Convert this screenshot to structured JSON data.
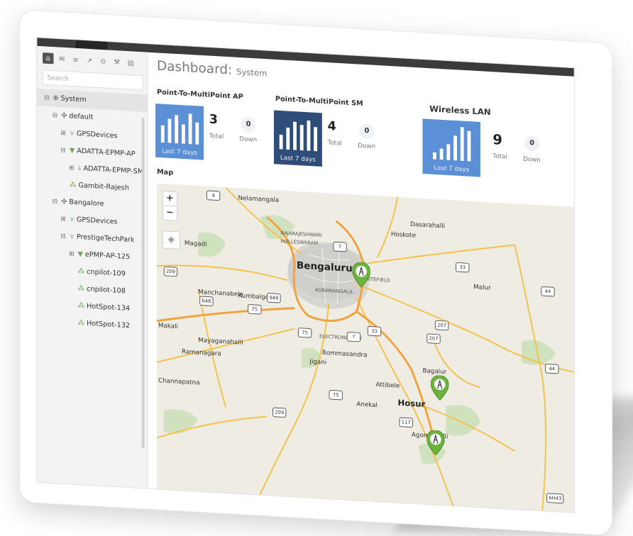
{
  "app": {
    "title": "Dashboard:",
    "subtitle": "System"
  },
  "sidebar": {
    "icons": [
      "home-icon",
      "megaphone-icon",
      "list-icon",
      "chart-icon",
      "location-icon",
      "wrench-icon",
      "table-icon"
    ],
    "search_placeholder": "Search",
    "tree": [
      {
        "label": "System",
        "depth": 0,
        "expander": "⊟",
        "icon": "globe-icon"
      },
      {
        "label": "default",
        "depth": 1,
        "expander": "⊟",
        "icon": "network-icon"
      },
      {
        "label": "GPSDevices",
        "depth": 2,
        "expander": "⊞",
        "icon": "tower-icon"
      },
      {
        "label": "ADATTA-EPMP-AP",
        "depth": 2,
        "expander": "⊟",
        "icon": "ap-icon"
      },
      {
        "label": "ADATTA-EPMP-SM",
        "depth": 3,
        "expander": "⊞",
        "icon": "sm-icon"
      },
      {
        "label": "Gambit-Rajesh",
        "depth": 2,
        "expander": "",
        "icon": "switch-icon"
      },
      {
        "label": "Bangalore",
        "depth": 1,
        "expander": "⊟",
        "icon": "network-icon"
      },
      {
        "label": "GPSDevices",
        "depth": 2,
        "expander": "⊞",
        "icon": "tower-icon"
      },
      {
        "label": "PrestigeTechPark",
        "depth": 2,
        "expander": "⊟",
        "icon": "tower-icon"
      },
      {
        "label": "ePMP-AP-125",
        "depth": 3,
        "expander": "⊞",
        "icon": "ap-icon"
      },
      {
        "label": "cnpilot-109",
        "depth": 3,
        "expander": "",
        "icon": "switch-icon"
      },
      {
        "label": "cnpilot-108",
        "depth": 3,
        "expander": "",
        "icon": "switch-icon"
      },
      {
        "label": "HotSpot-134",
        "depth": 3,
        "expander": "",
        "icon": "switch-icon"
      },
      {
        "label": "HotSpot-132",
        "depth": 3,
        "expander": "",
        "icon": "switch-icon"
      }
    ]
  },
  "cards": [
    {
      "title": "Point-To-MultiPoint AP",
      "chart_label": "Last 7 days",
      "total": "3",
      "total_label": "Total",
      "down": "0",
      "down_label": "Down",
      "color": "#5b8fd6",
      "bars": [
        0.55,
        0.75,
        0.9,
        0.6,
        0.95,
        0.7
      ]
    },
    {
      "title": "Point-To-MultiPoint SM",
      "chart_label": "Last 7 days",
      "total": "4",
      "total_label": "Total",
      "down": "0",
      "down_label": "Down",
      "color": "#2e4d78",
      "bars": [
        0.45,
        0.7,
        0.9,
        0.8,
        0.95,
        0.75
      ]
    },
    {
      "title": "Wireless LAN",
      "chart_label": "Last 7 days",
      "total": "9",
      "total_label": "Total",
      "down": "0",
      "down_label": "Down",
      "color": "#5b8fd6",
      "bars": [
        0.2,
        0.3,
        0.45,
        0.7,
        0.95,
        0.85
      ]
    }
  ],
  "map": {
    "label": "Map",
    "zoom_in": "+",
    "zoom_out": "−",
    "places": [
      "Bengaluru",
      "Hosur",
      "Nelamangala",
      "Hoskote",
      "Dasarahalli",
      "Magadi",
      "Malur",
      "Kumbalgodu",
      "Manchanabele",
      "Ramanagara",
      "Mayaganahalli",
      "Channapatna",
      "Bommasandra",
      "Jigani",
      "Attibele",
      "Anekal",
      "Bagalur",
      "Agondapalli",
      "Makali",
      "WHITEFIELD",
      "ELECTRONIC CITY",
      "MALLESWARAM",
      "KORAMANGALA",
      "RAJARAJESHWARI"
    ],
    "routes": [
      "4",
      "7",
      "7",
      "75",
      "948",
      "209",
      "648",
      "75",
      "33",
      "207",
      "207",
      "44",
      "44",
      "33",
      "75",
      "209",
      "117",
      "AH43"
    ],
    "pins": [
      "tower-pin-bengaluru",
      "tower-pin-bagalur",
      "tower-pin-agondapalli"
    ]
  }
}
